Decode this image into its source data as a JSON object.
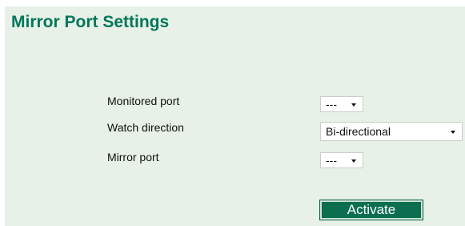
{
  "page": {
    "title": "Mirror Port Settings"
  },
  "form": {
    "monitored_port": {
      "label": "Monitored port",
      "value": "---"
    },
    "watch_direction": {
      "label": "Watch direction",
      "value": "Bi-directional"
    },
    "mirror_port": {
      "label": "Mirror port",
      "value": "---"
    }
  },
  "actions": {
    "activate_label": "Activate"
  },
  "colors": {
    "panel_background": "#e7f1e7",
    "title": "#00765a",
    "button": "#0a6e4f"
  }
}
